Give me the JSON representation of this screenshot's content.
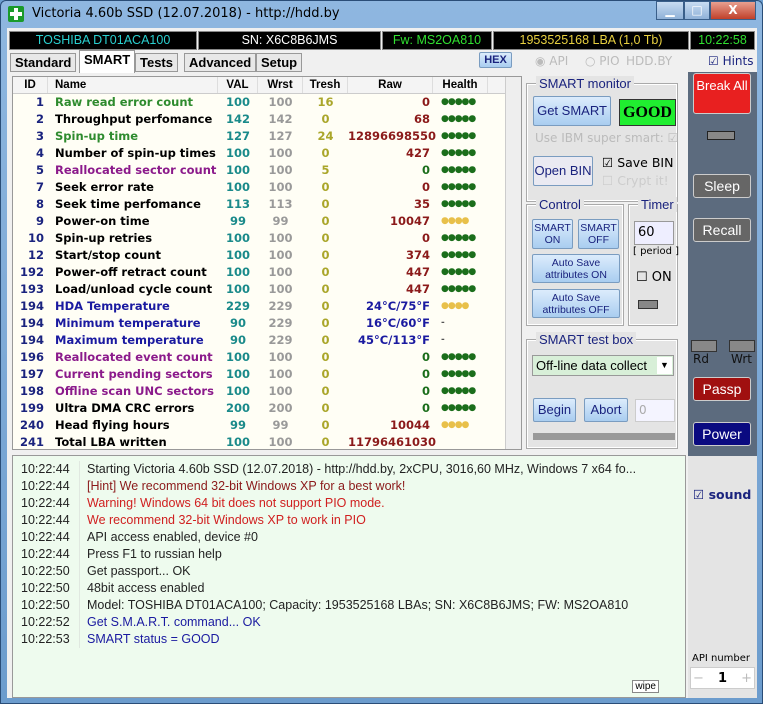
{
  "window": {
    "title": "Victoria 4.60b SSD (12.07.2018) - http://hdd.by",
    "controls": [
      "▁",
      "□",
      "X"
    ]
  },
  "infobar": {
    "model": "TOSHIBA DT01ACA100",
    "serial": "SN: X6C8B6JMS",
    "firmware": "Fw: MS2OA810",
    "capacity": "1953525168 LBA (1,0 Tb)",
    "clock": "10:22:58"
  },
  "tabs": [
    {
      "label": "Standard"
    },
    {
      "label": "SMART",
      "active": true
    },
    {
      "label": "Tests"
    },
    {
      "label": "Advanced"
    },
    {
      "label": "Setup"
    }
  ],
  "toolbar": {
    "hex": "HEX",
    "api": "API",
    "pio": "PIO",
    "hddby": "HDD.BY",
    "hints": "Hints"
  },
  "smart_table": {
    "columns": [
      "ID",
      "Name",
      "VAL",
      "Wrst",
      "Tresh",
      "Raw",
      "Health"
    ],
    "rows": [
      {
        "id": "1",
        "name": "Raw read error count",
        "val": "100",
        "wrst": "100",
        "tresh": "16",
        "raw": "0",
        "health": "●●●●●",
        "name_color": "#2e8b2e",
        "health_color": "#1b6e1b"
      },
      {
        "id": "2",
        "name": "Throughput perfomance",
        "val": "142",
        "wrst": "142",
        "tresh": "0",
        "raw": "68",
        "health": "●●●●●",
        "name_color": "#000000",
        "health_color": "#1b6e1b"
      },
      {
        "id": "3",
        "name": "Spin-up time",
        "val": "127",
        "wrst": "127",
        "tresh": "24",
        "raw": "12896698550",
        "health": "●●●●●",
        "name_color": "#2e8b2e",
        "health_color": "#1b6e1b"
      },
      {
        "id": "4",
        "name": "Number of spin-up times",
        "val": "100",
        "wrst": "100",
        "tresh": "0",
        "raw": "427",
        "health": "●●●●●",
        "name_color": "#000000",
        "health_color": "#1b6e1b"
      },
      {
        "id": "5",
        "name": "Reallocated sector count",
        "val": "100",
        "wrst": "100",
        "tresh": "5",
        "raw": "0",
        "health": "●●●●●",
        "name_color": "#8b1a8b",
        "health_color": "#1b6e1b",
        "raw_color": "#1b6e1b"
      },
      {
        "id": "7",
        "name": "Seek error rate",
        "val": "100",
        "wrst": "100",
        "tresh": "0",
        "raw": "0",
        "health": "●●●●●",
        "name_color": "#000000",
        "health_color": "#1b6e1b"
      },
      {
        "id": "8",
        "name": "Seek time perfomance",
        "val": "113",
        "wrst": "113",
        "tresh": "0",
        "raw": "35",
        "health": "●●●●●",
        "name_color": "#000000",
        "health_color": "#1b6e1b"
      },
      {
        "id": "9",
        "name": "Power-on time",
        "val": "99",
        "wrst": "99",
        "tresh": "0",
        "raw": "10047",
        "health": "●●●●",
        "name_color": "#000000",
        "health_color": "#e8c04a"
      },
      {
        "id": "10",
        "name": "Spin-up retries",
        "val": "100",
        "wrst": "100",
        "tresh": "0",
        "raw": "0",
        "health": "●●●●●",
        "name_color": "#000000",
        "health_color": "#1b6e1b"
      },
      {
        "id": "12",
        "name": "Start/stop count",
        "val": "100",
        "wrst": "100",
        "tresh": "0",
        "raw": "374",
        "health": "●●●●●",
        "name_color": "#000000",
        "health_color": "#1b6e1b"
      },
      {
        "id": "192",
        "name": "Power-off retract count",
        "val": "100",
        "wrst": "100",
        "tresh": "0",
        "raw": "447",
        "health": "●●●●●",
        "name_color": "#000000",
        "health_color": "#1b6e1b"
      },
      {
        "id": "193",
        "name": "Load/unload cycle count",
        "val": "100",
        "wrst": "100",
        "tresh": "0",
        "raw": "447",
        "health": "●●●●●",
        "name_color": "#000000",
        "health_color": "#1b6e1b"
      },
      {
        "id": "194",
        "name": "HDA Temperature",
        "val": "229",
        "wrst": "229",
        "tresh": "0",
        "raw": "24°C/75°F",
        "health": "●●●●",
        "name_color": "#1a1aa0",
        "health_color": "#e8c04a",
        "raw_color": "#1a1aa0"
      },
      {
        "id": "194",
        "name": "Minimum temperature",
        "val": "90",
        "wrst": "229",
        "tresh": "0",
        "raw": "16°C/60°F",
        "health": "-",
        "name_color": "#1a1aa0",
        "health_color": "#555555",
        "raw_color": "#1a1aa0"
      },
      {
        "id": "194",
        "name": "Maximum temperature",
        "val": "90",
        "wrst": "229",
        "tresh": "0",
        "raw": "45°C/113°F",
        "health": "-",
        "name_color": "#1a1aa0",
        "health_color": "#555555",
        "raw_color": "#1a1aa0"
      },
      {
        "id": "196",
        "name": "Reallocated event count",
        "val": "100",
        "wrst": "100",
        "tresh": "0",
        "raw": "0",
        "health": "●●●●●",
        "name_color": "#8b1a8b",
        "health_color": "#1b6e1b",
        "raw_color": "#1b6e1b"
      },
      {
        "id": "197",
        "name": "Current pending sectors",
        "val": "100",
        "wrst": "100",
        "tresh": "0",
        "raw": "0",
        "health": "●●●●●",
        "name_color": "#8b1a8b",
        "health_color": "#1b6e1b",
        "raw_color": "#1b6e1b"
      },
      {
        "id": "198",
        "name": "Offline scan UNC sectors",
        "val": "100",
        "wrst": "100",
        "tresh": "0",
        "raw": "0",
        "health": "●●●●●",
        "name_color": "#8b1a8b",
        "health_color": "#1b6e1b",
        "raw_color": "#1b6e1b"
      },
      {
        "id": "199",
        "name": "Ultra DMA CRC errors",
        "val": "200",
        "wrst": "200",
        "tresh": "0",
        "raw": "0",
        "health": "●●●●●",
        "name_color": "#000000",
        "health_color": "#1b6e1b",
        "raw_color": "#1b6e1b"
      },
      {
        "id": "240",
        "name": "Head flying hours",
        "val": "99",
        "wrst": "99",
        "tresh": "0",
        "raw": "10044",
        "health": "●●●●",
        "name_color": "#000000",
        "health_color": "#e8c04a"
      },
      {
        "id": "241",
        "name": "Total LBA written",
        "val": "100",
        "wrst": "100",
        "tresh": "0",
        "raw": "11796461030",
        "health": "",
        "name_color": "#000000",
        "health_color": "#1b6e1b"
      }
    ]
  },
  "smart_monitor": {
    "title": "SMART monitor",
    "get_smart": "Get SMART",
    "status": "GOOD",
    "ibm": "Use IBM super smart:",
    "open_bin": "Open BIN",
    "save_bin": "Save BIN",
    "crypt": "Crypt it!"
  },
  "control": {
    "title": "Control",
    "smart_on": "SMART ON",
    "smart_off": "SMART OFF",
    "auto_on": "Auto Save attributes ON",
    "auto_off": "Auto Save attributes OFF"
  },
  "timer": {
    "title": "Timer",
    "value": "60",
    "period": "[ period ]",
    "on": "ON"
  },
  "test_box": {
    "title": "SMART test box",
    "selected": "Off-line data collect",
    "begin": "Begin",
    "abort": "Abort",
    "progress_value": "0"
  },
  "side": {
    "break_all": "Break All",
    "sleep": "Sleep",
    "recall": "Recall",
    "rd": "Rd",
    "wrt": "Wrt",
    "passp": "Passp",
    "power": "Power",
    "sound": "sound",
    "api_number_label": "API number",
    "api_number": "1",
    "minus": "−",
    "plus": "+"
  },
  "log": {
    "wipe": "wipe",
    "entries": [
      {
        "time": "10:22:44",
        "msg": "Starting Victoria 4.60b SSD (12.07.2018) - http://hdd.by, 2xCPU, 3016,60 MHz, Windows 7 x64 fo...",
        "color": "#222222"
      },
      {
        "time": "10:22:44",
        "msg": "[Hint] We recommend 32-bit Windows XP for a best work!",
        "color": "#8b1a1a"
      },
      {
        "time": "10:22:44",
        "msg": "Warning! Windows 64 bit does not support PIO mode.",
        "color": "#d02020"
      },
      {
        "time": "10:22:44",
        "msg": "We recommend 32-bit Windows XP to work in PIO",
        "color": "#d02020"
      },
      {
        "time": "10:22:44",
        "msg": "API access enabled, device #0",
        "color": "#222222"
      },
      {
        "time": "10:22:44",
        "msg": "Press F1 to russian help",
        "color": "#222222"
      },
      {
        "time": "10:22:50",
        "msg": "Get passport... OK",
        "color": "#222222"
      },
      {
        "time": "10:22:50",
        "msg": "48bit access enabled",
        "color": "#222222"
      },
      {
        "time": "10:22:50",
        "msg": "Model: TOSHIBA DT01ACA100; Capacity: 1953525168 LBAs; SN: X6C8B6JMS; FW: MS2OA810",
        "color": "#222222"
      },
      {
        "time": "10:22:52",
        "msg": "Get S.M.A.R.T. command... OK",
        "color": "#1a1aa0"
      },
      {
        "time": "10:22:53",
        "msg": "SMART status = GOOD",
        "color": "#1a1aa0"
      }
    ]
  }
}
